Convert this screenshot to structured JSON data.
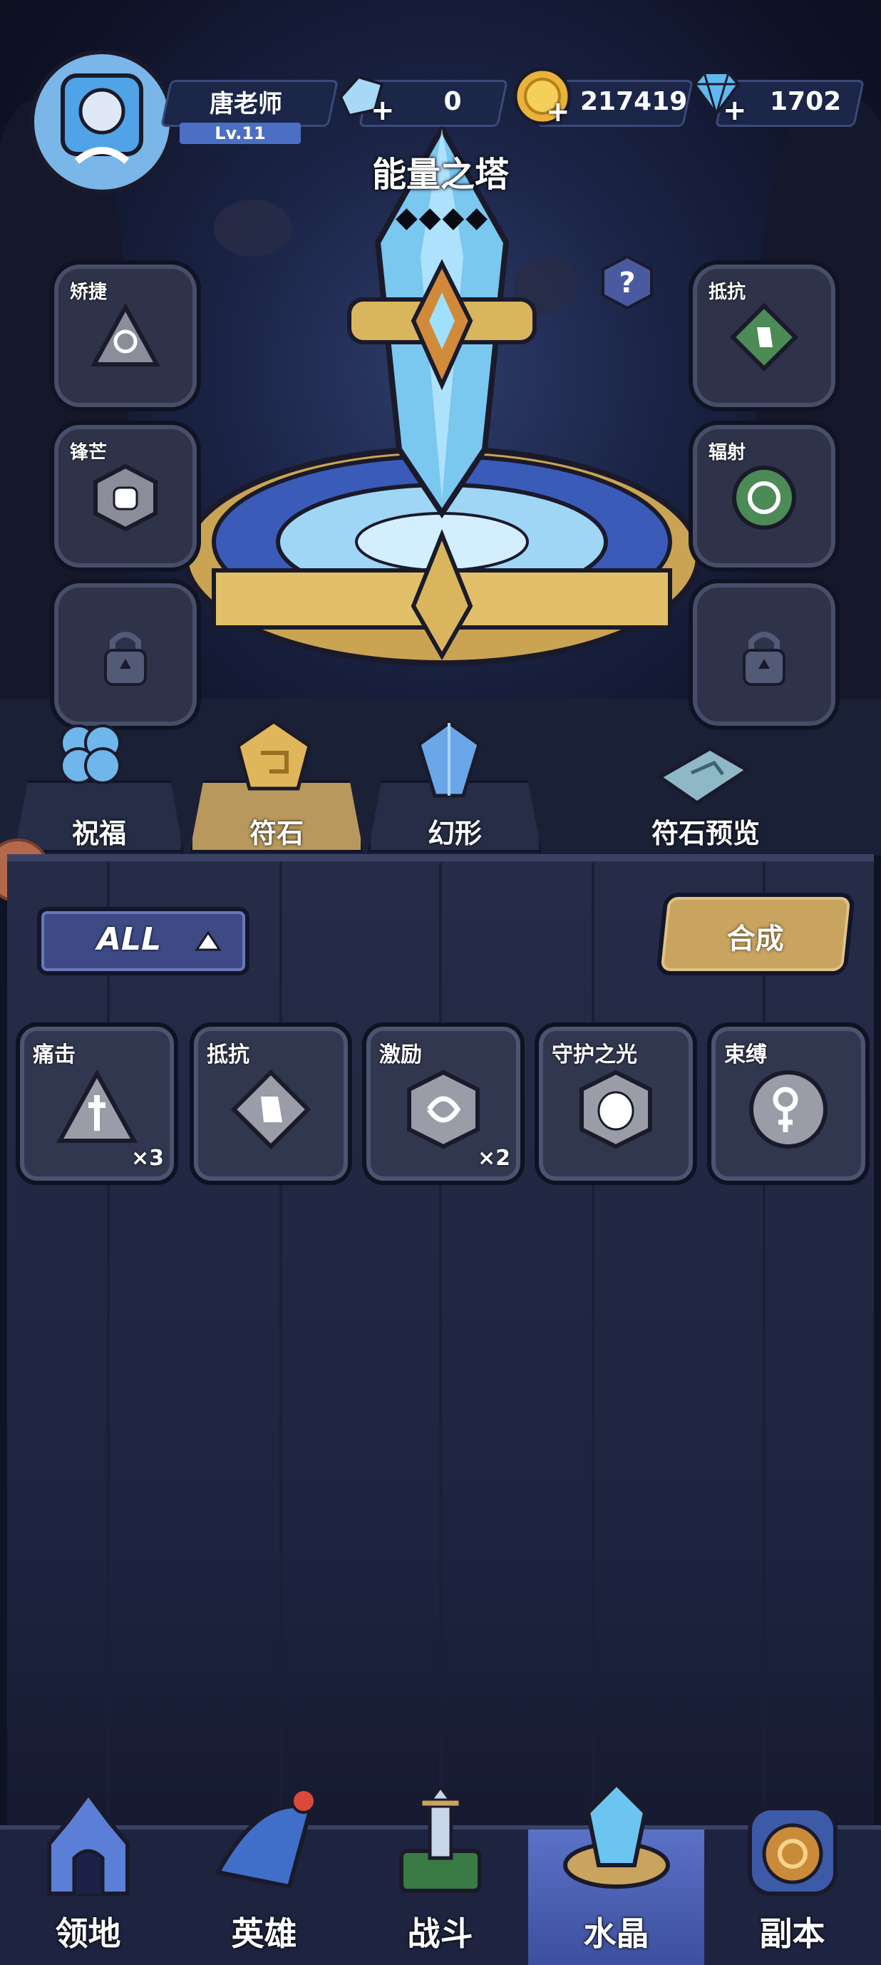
{
  "player": {
    "name": "唐老师",
    "level": "Lv.11"
  },
  "resources": {
    "shard": "0",
    "gold": "217419",
    "diamond": "1702"
  },
  "tower": {
    "title": "能量之塔"
  },
  "slots": {
    "left": [
      {
        "label": "矫捷"
      },
      {
        "label": "锋芒"
      },
      {
        "label": ""
      }
    ],
    "right": [
      {
        "label": "抵抗"
      },
      {
        "label": "辐射"
      },
      {
        "label": ""
      }
    ]
  },
  "tabs": [
    {
      "label": "祝福"
    },
    {
      "label": "符石"
    },
    {
      "label": "幻形"
    },
    {
      "label": "符石预览"
    }
  ],
  "filter": {
    "label": "ALL"
  },
  "synthesize": {
    "label": "合成"
  },
  "items": [
    {
      "label": "痛击",
      "count": "×3"
    },
    {
      "label": "抵抗",
      "count": ""
    },
    {
      "label": "激励",
      "count": "×2"
    },
    {
      "label": "守护之光",
      "count": ""
    },
    {
      "label": "束缚",
      "count": ""
    }
  ],
  "nav": [
    {
      "label": "领地"
    },
    {
      "label": "英雄"
    },
    {
      "label": "战斗"
    },
    {
      "label": "水晶"
    },
    {
      "label": "副本"
    }
  ],
  "colors": {
    "accent_gold": "#c9a45e",
    "crystal_blue": "#6cc4f0",
    "panel": "#262c48"
  }
}
